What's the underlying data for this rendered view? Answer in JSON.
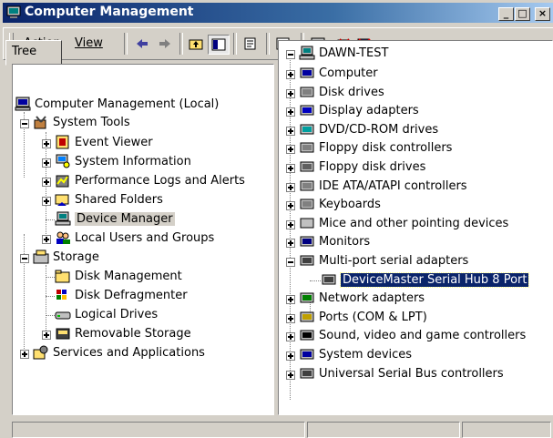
{
  "window": {
    "title": "Computer Management"
  },
  "title_buttons": {
    "minimize": "_",
    "maximize": "□",
    "close": "×"
  },
  "menu": {
    "action": "Action",
    "view": "View"
  },
  "toolbar": {
    "icons": [
      "back-icon",
      "forward-icon",
      "up-folder-icon",
      "show-hide-tree-icon",
      "properties-icon",
      "help-icon",
      "scan-hardware-icon",
      "uninstall-icon",
      "disable-icon"
    ]
  },
  "left_pane": {
    "tab": "Tree",
    "root": "Computer Management (Local)",
    "system_tools": "System Tools",
    "event_viewer": "Event Viewer",
    "system_information": "System Information",
    "performance_logs": "Performance Logs and Alerts",
    "shared_folders": "Shared Folders",
    "device_manager": "Device Manager",
    "local_users": "Local Users and Groups",
    "storage": "Storage",
    "disk_management": "Disk Management",
    "disk_defragmenter": "Disk Defragmenter",
    "logical_drives": "Logical Drives",
    "removable_storage": "Removable Storage",
    "services_apps": "Services and Applications"
  },
  "right_pane": {
    "root": "DAWN-TEST",
    "items": [
      "Computer",
      "Disk drives",
      "Display adapters",
      "DVD/CD-ROM drives",
      "Floppy disk controllers",
      "Floppy disk drives",
      "IDE ATA/ATAPI controllers",
      "Keyboards",
      "Mice and other pointing devices",
      "Monitors",
      "Multi-port serial adapters",
      "DeviceMaster Serial Hub 8 Port",
      "Network adapters",
      "Ports (COM & LPT)",
      "Sound, video and game controllers",
      "System devices",
      "Universal Serial Bus controllers"
    ]
  }
}
